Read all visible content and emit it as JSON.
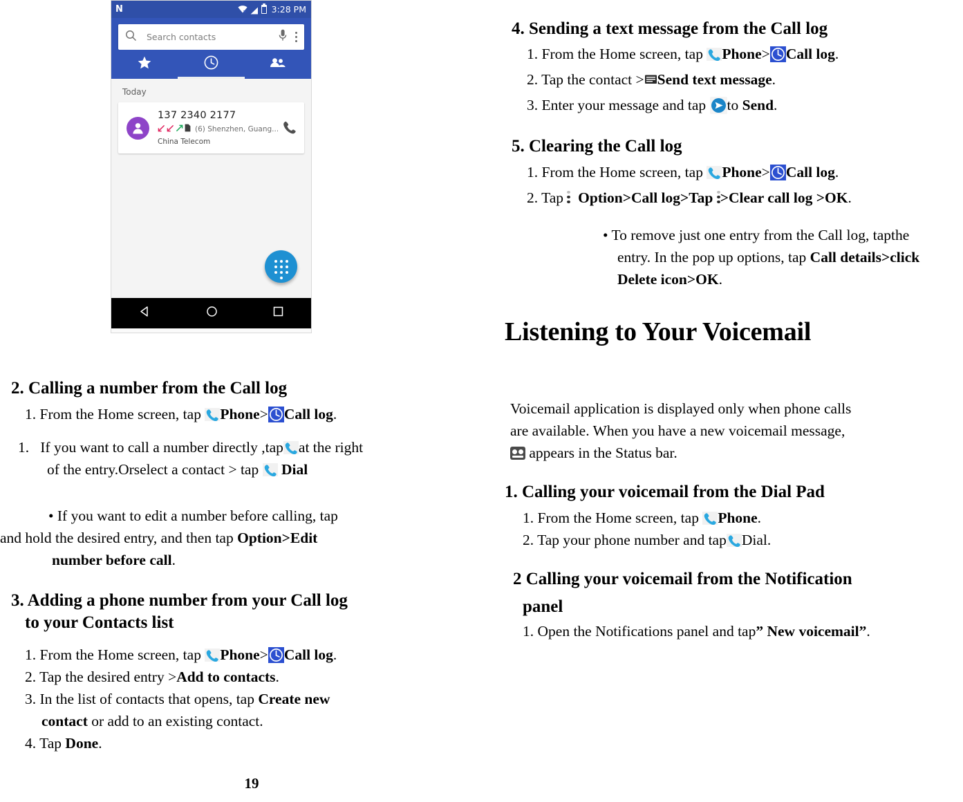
{
  "document": {
    "page_number": "19"
  },
  "phone_screenshot": {
    "status_bar": {
      "logo": "N",
      "time": "3:28 PM",
      "icons": [
        "wifi-icon",
        "signal-icon",
        "battery-icon"
      ]
    },
    "search": {
      "placeholder": "Search contacts",
      "search_icon": "search-icon",
      "mic_icon": "microphone-icon",
      "overflow_icon": "kebab-menu-icon"
    },
    "tabs": [
      {
        "name": "favorites",
        "icon": "star-icon",
        "selected": false
      },
      {
        "name": "call-log",
        "icon": "clock-icon",
        "selected": true
      },
      {
        "name": "contacts",
        "icon": "people-icon",
        "selected": false
      }
    ],
    "list": {
      "section_label": "Today",
      "entry": {
        "number": "137 2340 2177",
        "location": "(6) Shenzhen, Guang...",
        "carrier": "China Telecom",
        "call_type_icons": [
          "missed-call-icon",
          "missed-call-icon",
          "outgoing-call-icon",
          "sim-icon"
        ],
        "action_icon": "call-icon"
      }
    },
    "fab": {
      "icon": "dialpad-icon",
      "color": "#1e90d2"
    },
    "nav_bar": {
      "icons": [
        "back-icon",
        "home-icon",
        "recents-icon"
      ]
    }
  },
  "left_column": {
    "section2": {
      "heading": "2. Calling a number from the Call log",
      "step1_a": "1. From the Home screen, tap",
      "step1_phone": "Phone",
      "step1_gt": ">",
      "step1_calllog": "Call log",
      "step1_end": ".",
      "sub1_a": "1.   If you want to call a number directly ,tap",
      "sub1_b": "at the right",
      "sub1_c": "of the entry.Orselect a contact > tap",
      "sub1_dial": "Dial",
      "bullet_a": "• If you want to edit a number before calling, tap",
      "bullet_b": "and hold the desired entry, and then tap",
      "bullet_option": "Option",
      "bullet_gt": ">",
      "bullet_edit": "Edit",
      "bullet_edit2": "number before call",
      "bullet_end": "."
    },
    "section3": {
      "heading_line1": "3. Adding a phone number from your Call log",
      "heading_line2": "to your Contacts list",
      "step1_a": "1. From the Home screen, tap",
      "step1_phone": "Phone",
      "step1_gt": ">",
      "step1_calllog": "Call log",
      "step1_end": ".",
      "step2_a": "2. Tap the desired entry >",
      "step2_b": "Add to contacts",
      "step2_end": ".",
      "step3_a": "3. In the list of contacts that opens, tap",
      "step3_b": "Create new",
      "step3_c": "contact",
      "step3_d": " or add to an existing contact.",
      "step4_a": "4. Tap ",
      "step4_b": "Done",
      "step4_end": "."
    }
  },
  "right_column": {
    "section4": {
      "heading": "4. Sending a text message from the Call log",
      "step1_a": "1. From the Home screen, tap",
      "step1_phone": "Phone",
      "step1_gt": ">",
      "step1_calllog": "Call log",
      "step1_end": ".",
      "step2_a": "2. Tap the contact >",
      "step2_b": "Send text message",
      "step2_end": ".",
      "step3_a": "3. Enter your message and tap",
      "step3_b": "to ",
      "step3_c": "Send",
      "step3_end": "."
    },
    "section5": {
      "heading": "5. Clearing the Call log",
      "step1_a": "1. From the Home screen, tap",
      "step1_phone": "Phone",
      "step1_gt": ">",
      "step1_calllog": "Call log",
      "step1_end": ".",
      "step2_a": "2. Tap",
      "step2_b": "Option>Call log>Tap",
      "step2_c": ">Clear call log",
      "step2_d": ">OK",
      "step2_end": ".",
      "bullet_a": "• To remove just one entry from the Call log, tapthe",
      "bullet_b": "entry. In the pop up options, tap",
      "bullet_c": "Call details>click",
      "bullet_d": "Delete icon>OK",
      "bullet_end": "."
    },
    "voicemail": {
      "heading": "Listening to Your Voicemail",
      "para_line1": "Voicemail application is displayed only when phone calls",
      "para_line2": "are available. When you have a new voicemail message,",
      "para_line3": "appears in the Status bar.",
      "sub1": {
        "heading": "1. Calling your voicemail from the Dial Pad",
        "step1_a": "1. From the Home screen, tap",
        "step1_phone": "Phone",
        "step1_end": ".",
        "step2_a": "2. Tap your phone number and tap",
        "step2_b": "Dial",
        "step2_end": "."
      },
      "sub2": {
        "heading_line1": "2 Calling your voicemail from the Notification",
        "heading_line2": "panel",
        "step1_a": "1. Open the Notifications panel and tap",
        "step1_b": "” New voicemail”",
        "step1_end": "."
      }
    }
  }
}
